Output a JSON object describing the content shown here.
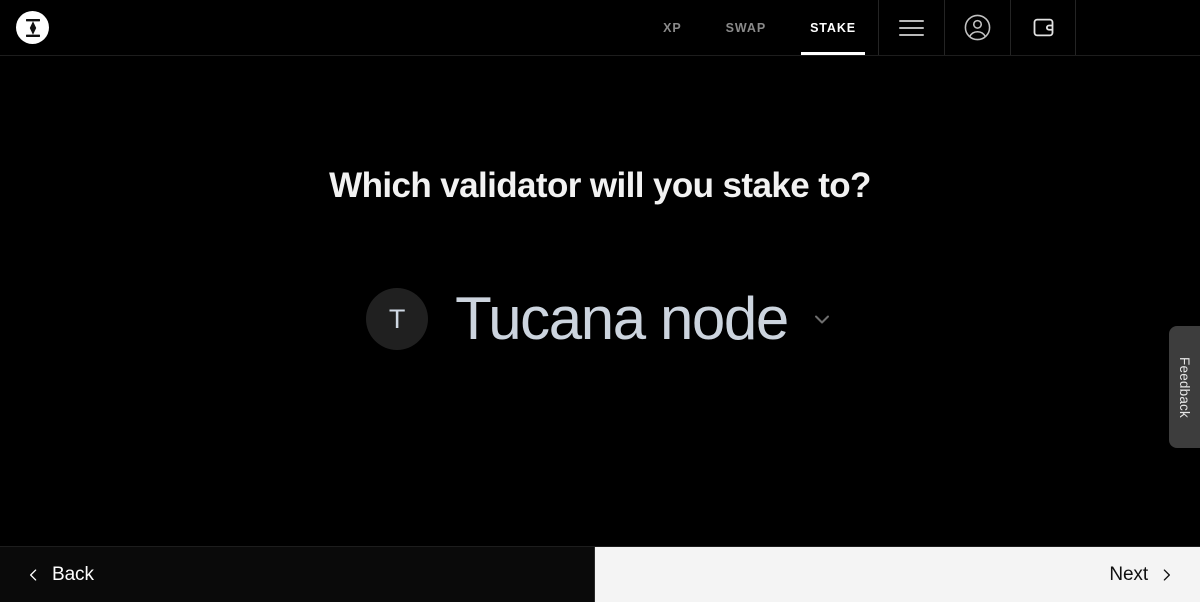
{
  "brand": {
    "logo_icon": "bone-logo-icon",
    "logo_bg": "#ffffff"
  },
  "header": {
    "nav": [
      {
        "label": "XP",
        "active": false
      },
      {
        "label": "SWAP",
        "active": false
      },
      {
        "label": "STAKE",
        "active": true
      }
    ],
    "icons": [
      {
        "name": "hamburger-menu-icon",
        "label": "Menu"
      },
      {
        "name": "user-account-icon",
        "label": "Account"
      },
      {
        "name": "wallet-icon",
        "label": "Wallet"
      }
    ],
    "active_color": "#ffffff",
    "inactive_color": "#8a8a8a"
  },
  "main": {
    "headline": "Which validator will you stake to?",
    "validator": {
      "avatar_initial": "T",
      "name": "Tucana node",
      "dropdown_icon": "chevron-down-icon"
    }
  },
  "feedback": {
    "label": "Feedback",
    "bg": "#3d3d3d"
  },
  "footer": {
    "back": {
      "label": "Back",
      "icon": "chevron-left-icon"
    },
    "next": {
      "label": "Next",
      "icon": "chevron-right-icon"
    },
    "back_bg": "#0a0a0a",
    "next_bg": "#f4f4f4"
  }
}
